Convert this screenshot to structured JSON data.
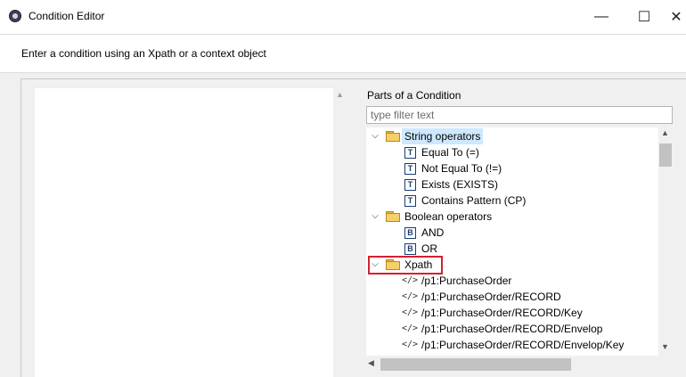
{
  "window": {
    "title": "Condition Editor",
    "minimize_glyph": "—",
    "maximize_glyph": "☐",
    "close_glyph": "✕"
  },
  "instruction": "Enter a condition using an Xpath or a context object",
  "parts_label": "Parts of a Condition",
  "filter": {
    "placeholder": "type filter text",
    "value": ""
  },
  "tree": {
    "groups": [
      {
        "label": "String operators",
        "expanded": true,
        "selected": true,
        "items": [
          {
            "icon": "T",
            "label": "Equal To (=)"
          },
          {
            "icon": "T",
            "label": "Not Equal To (!=)"
          },
          {
            "icon": "T",
            "label": "Exists (EXISTS)"
          },
          {
            "icon": "T",
            "label": "Contains Pattern (CP)"
          }
        ]
      },
      {
        "label": "Boolean operators",
        "expanded": true,
        "items": [
          {
            "icon": "B",
            "label": "AND"
          },
          {
            "icon": "B",
            "label": "OR"
          }
        ]
      },
      {
        "label": "Xpath",
        "expanded": true,
        "highlighted": true,
        "items": [
          {
            "icon": "</>",
            "label": "/p1:PurchaseOrder"
          },
          {
            "icon": "</>",
            "label": "/p1:PurchaseOrder/RECORD"
          },
          {
            "icon": "</>",
            "label": "/p1:PurchaseOrder/RECORD/Key"
          },
          {
            "icon": "</>",
            "label": "/p1:PurchaseOrder/RECORD/Envelop"
          },
          {
            "icon": "</>",
            "label": "/p1:PurchaseOrder/RECORD/Envelop/Key"
          }
        ]
      }
    ]
  },
  "colors": {
    "highlight_border": "#d6202f",
    "selection_bg": "#cde8ff",
    "folder": "#f5cf6a"
  }
}
